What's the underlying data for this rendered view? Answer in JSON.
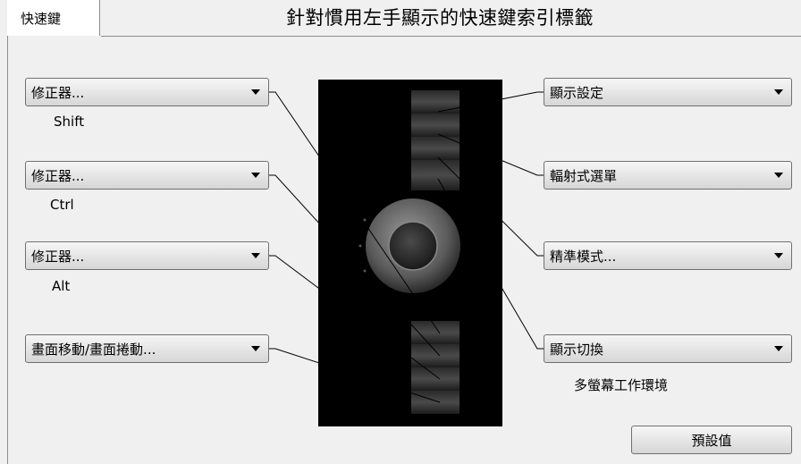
{
  "tab": {
    "label": "快速鍵"
  },
  "title": "針對慣用左手顯示的快速鍵索引標籤",
  "left_dropdowns": [
    {
      "label": "修正器...",
      "sub": "Shift"
    },
    {
      "label": "修正器...",
      "sub": "Ctrl"
    },
    {
      "label": "修正器...",
      "sub": "Alt"
    },
    {
      "label": "畫面移動/畫面捲動...",
      "sub": ""
    }
  ],
  "right_dropdowns": [
    {
      "label": "顯示設定",
      "sub": ""
    },
    {
      "label": "輻射式選單",
      "sub": ""
    },
    {
      "label": "精準模式...",
      "sub": ""
    },
    {
      "label": "顯示切換",
      "sub": "多螢幕工作環境"
    }
  ],
  "default_button": "預設值",
  "colors": {
    "background": "#f0f0f0",
    "device": "#000000",
    "connector": "#000000"
  }
}
